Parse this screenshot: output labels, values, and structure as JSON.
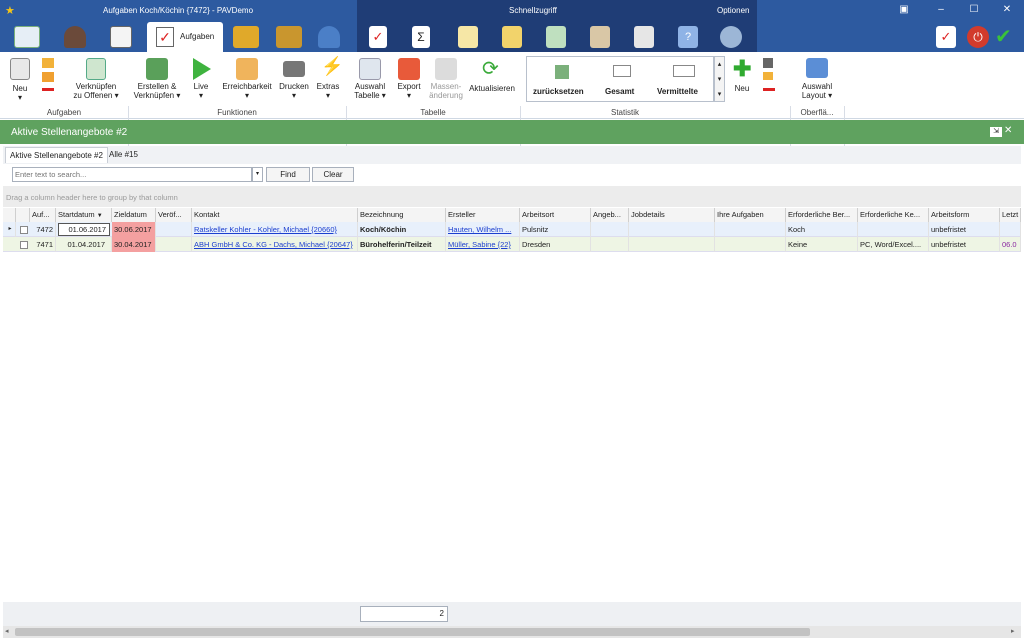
{
  "window": {
    "title": "Aufgaben Koch/Köchin {7472} - PAVDemo"
  },
  "quick_access": {
    "label": "Schnellzugriff",
    "options_label": "Optionen"
  },
  "tabs": {
    "active_label": "Aufgaben"
  },
  "ribbon": {
    "neu": "Neu",
    "verknuepfen": "Verknüpfen",
    "zu_offenen": "zu Offenen",
    "erstellen": "Erstellen &",
    "verknuepfen2": "Verknüpfen",
    "live": "Live",
    "erreichbarkeit": "Erreichbarkeit",
    "drucken": "Drucken",
    "extras": "Extras",
    "auswahl": "Auswahl",
    "tabelle": "Tabelle",
    "export": "Export",
    "massen": "Massen-",
    "aenderung": "änderung",
    "aktualisieren": "Aktualisieren",
    "zuruecksetzen": "zurücksetzen",
    "gesamt": "Gesamt",
    "vermittelte": "Vermittelte",
    "neu2": "Neu",
    "auswahl2": "Auswahl",
    "layout": "Layout",
    "groups": [
      "Aufgaben",
      "Funktionen",
      "Tabelle",
      "Statistik",
      "Oberflä..."
    ]
  },
  "panel": {
    "title": "Aktive Stellenangebote #2"
  },
  "doc_tabs": [
    "Aktive Stellenangebote #2",
    "Alle #15"
  ],
  "search": {
    "placeholder": "Enter text to search...",
    "find": "Find",
    "clear": "Clear"
  },
  "group_hint": "Drag a column header here to group by that column",
  "columns": [
    "Auf...",
    "Startdatum",
    "Zieldatum",
    "Veröf...",
    "Kontakt",
    "Bezeichnung",
    "Ersteller",
    "Arbeitsort",
    "Angeb...",
    "Jobdetails",
    "Ihre Aufgaben",
    "Erforderliche Ber...",
    "Erforderliche Ke...",
    "Arbeitsform",
    "Letzt"
  ],
  "rows": [
    [
      "7472",
      "01.06.2017",
      "30.06.2017",
      "",
      "Ratskeller Kohler - Kohler, Michael {20660}",
      "Koch/Köchin",
      "Hauten, Wilhelm ...",
      "Pulsnitz",
      "",
      "",
      "",
      "Koch",
      "",
      "unbefristet",
      ""
    ],
    [
      "7471",
      "01.04.2017",
      "30.04.2017",
      "",
      "ABH GmbH & Co. KG - Dachs, Michael {20647}",
      "Bürohelferin/Teilzeit",
      "Müller, Sabine {22}",
      "Dresden",
      "",
      "",
      "",
      "Keine",
      "PC, Word/Excel....",
      "unbefristet",
      "06.0"
    ]
  ],
  "footer": {
    "count": "2"
  },
  "colors": {
    "title_blue": "#2d5aa0",
    "header_green": "#5fa25f",
    "due_red": "#f4a0a0",
    "row_selected": "#e8f0fb",
    "row_alt": "#eef5e4"
  }
}
